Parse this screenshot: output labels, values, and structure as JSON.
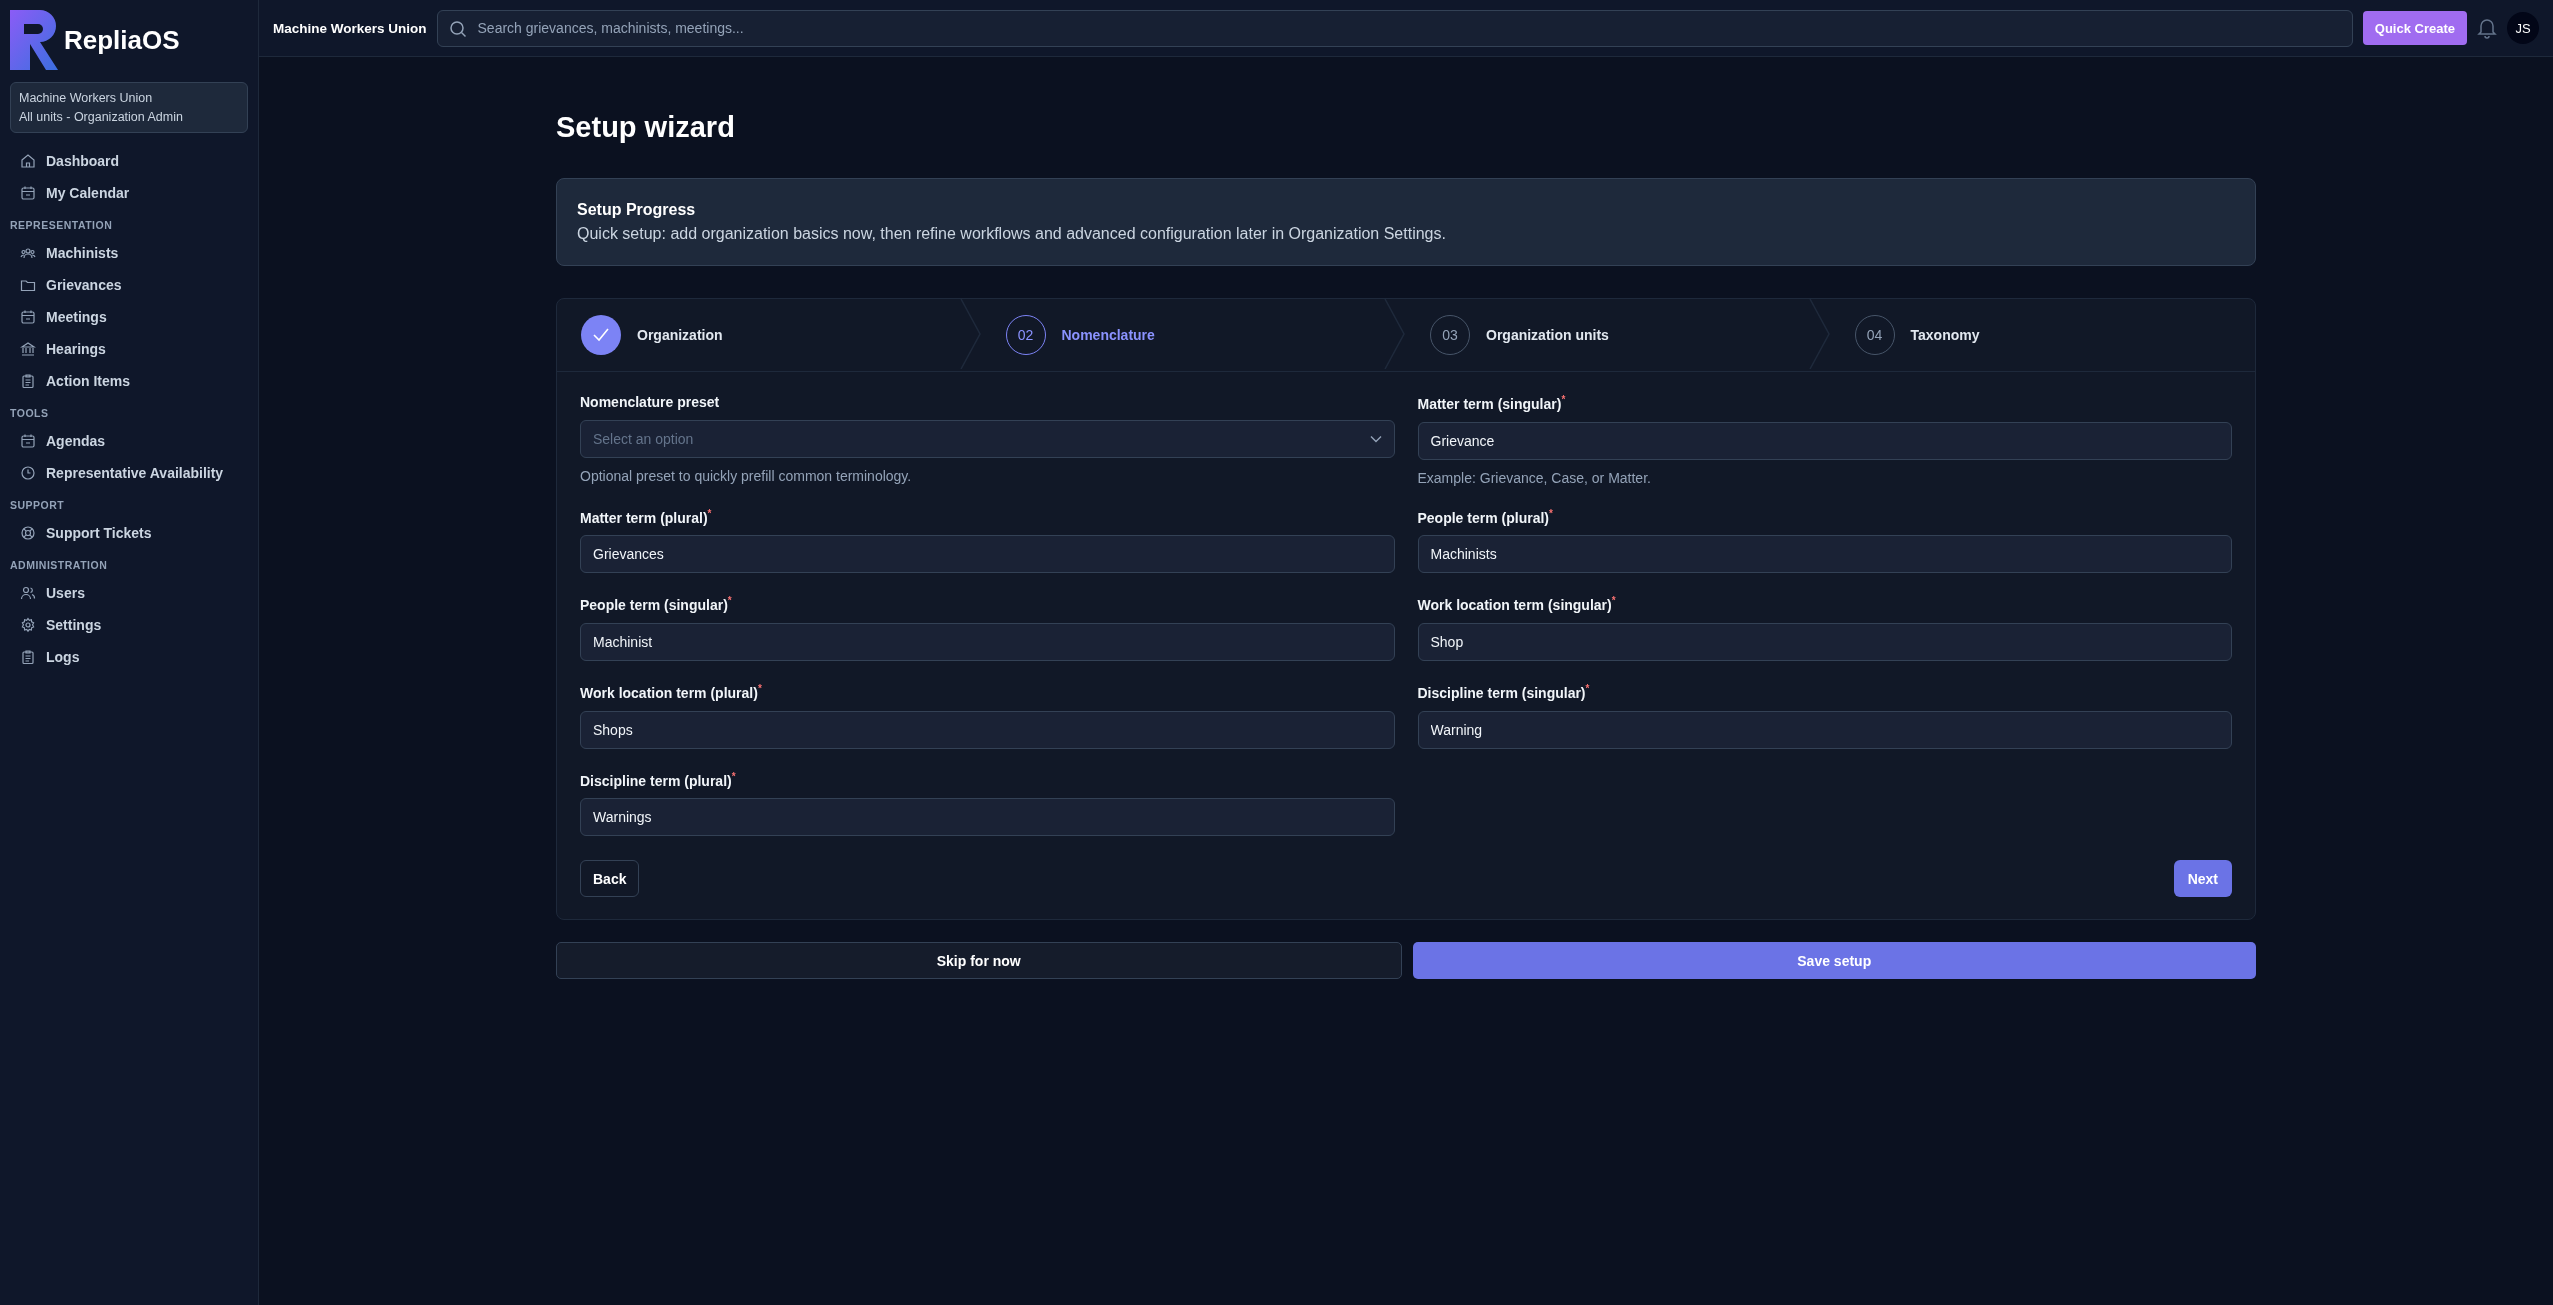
{
  "sidebar": {
    "brand": "RepliaOS",
    "org": {
      "name": "Machine Workers Union",
      "role": "All units - Organization Admin"
    },
    "sections": [
      {
        "items": [
          {
            "label": "Dashboard"
          },
          {
            "label": "My Calendar"
          }
        ]
      },
      {
        "heading": "REPRESENTATION",
        "items": [
          {
            "label": "Machinists"
          },
          {
            "label": "Grievances"
          },
          {
            "label": "Meetings"
          },
          {
            "label": "Hearings"
          },
          {
            "label": "Action Items"
          }
        ]
      },
      {
        "heading": "TOOLS",
        "items": [
          {
            "label": "Agendas"
          },
          {
            "label": "Representative Availability"
          }
        ]
      },
      {
        "heading": "SUPPORT",
        "items": [
          {
            "label": "Support Tickets"
          }
        ]
      },
      {
        "heading": "ADMINISTRATION",
        "items": [
          {
            "label": "Users"
          },
          {
            "label": "Settings"
          },
          {
            "label": "Logs"
          }
        ]
      }
    ]
  },
  "topbar": {
    "org": "Machine Workers Union",
    "search": {
      "placeholder": "Search grievances, machinists, meetings..."
    },
    "quick_create": "Quick Create",
    "avatar": "JS"
  },
  "page": {
    "title": "Setup wizard",
    "progress": {
      "title": "Setup Progress",
      "text": "Quick setup: add organization basics now, then refine workflows and advanced configuration later in Organization Settings."
    },
    "steps": [
      {
        "label": "Organization",
        "completed": true,
        "selected": false
      },
      {
        "number": "02",
        "label": "Nomenclature",
        "completed": false,
        "selected": true
      },
      {
        "number": "03",
        "label": "Organization units",
        "completed": false,
        "selected": false
      },
      {
        "number": "04",
        "label": "Taxonomy",
        "completed": false,
        "selected": false
      }
    ],
    "fields": [
      {
        "kind": "select",
        "label": "Nomenclature preset",
        "placeholder": "Select an option",
        "help": "Optional preset to quickly prefill common terminology."
      },
      {
        "kind": "text",
        "label": "Matter term (singular)$^{*}$",
        "value": "Grievance",
        "help": "Example: Grievance, Case, or Matter."
      },
      {
        "kind": "text",
        "label": "Matter term (plural)$^{*}$",
        "value": "Grievances"
      },
      {
        "kind": "text",
        "label": "People term (plural)$^{*}$",
        "value": "Machinists"
      },
      {
        "kind": "text",
        "label": "People term (singular)$^{*}$",
        "value": "Machinist"
      },
      {
        "kind": "text",
        "label": "Work location term (singular)$^{*}$",
        "value": "Shop"
      },
      {
        "kind": "text",
        "label": "Work location term (plural)$^{*}$",
        "value": "Shops"
      },
      {
        "kind": "text",
        "label": "Discipline term (singular)$^{*}$",
        "value": "Warning"
      },
      {
        "kind": "text",
        "label": "Discipline term (plural)$^{*}$",
        "value": "Warnings"
      }
    ],
    "back": "Back",
    "next": "Next",
    "skip": "Skip for now",
    "save": "Save setup"
  }
}
